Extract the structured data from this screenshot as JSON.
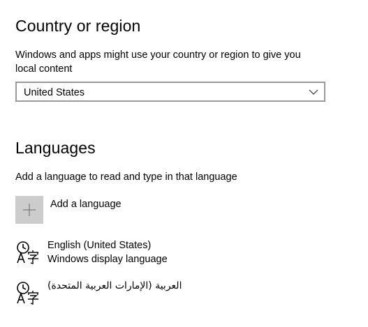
{
  "country_section": {
    "title": "Country or region",
    "description": "Windows and apps might use your country or region to give you local content",
    "selected_country": "United States",
    "dropdown_icon": "chevron-down-icon"
  },
  "languages_section": {
    "title": "Languages",
    "description": "Add a language to read and type in that language",
    "add_label": "Add a language",
    "add_icon": "plus-icon",
    "items": [
      {
        "name": "English (United States)",
        "subtitle": "Windows display language",
        "icon": "language-icon"
      },
      {
        "name": "العربية (الإمارات العربية المتحدة)",
        "icon": "language-icon"
      }
    ]
  },
  "colors": {
    "tile_background": "#cccccc",
    "border": "#999999"
  }
}
